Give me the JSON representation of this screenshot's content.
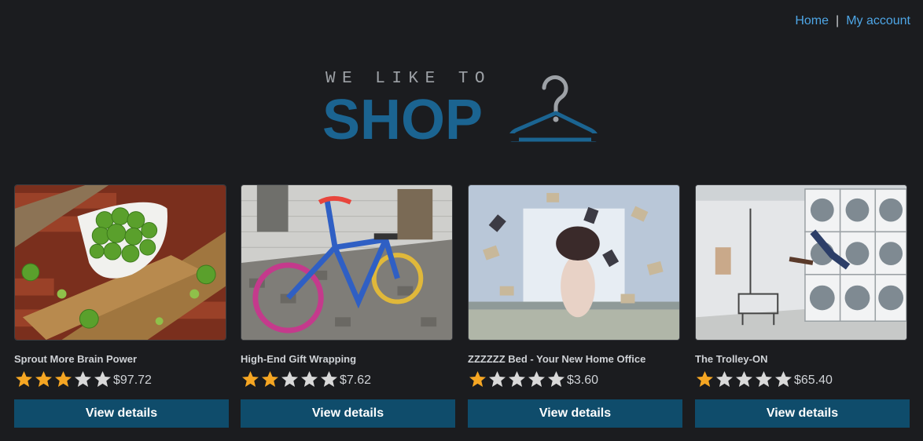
{
  "nav": {
    "home": "Home",
    "separator": "|",
    "account": "My account"
  },
  "logo": {
    "tagline": "WE LIKE TO",
    "word": "SHOP",
    "color": "#1b6491",
    "icon": "hanger-icon"
  },
  "colors": {
    "star_filled": "#f5a623",
    "star_empty": "#d9d9d9",
    "button_bg": "#0f4c6b",
    "link": "#4ea6e6"
  },
  "products": [
    {
      "name": "Sprout More Brain Power",
      "rating": 3,
      "max_rating": 5,
      "price": "$97.72",
      "button": "View details",
      "image": "brussels-sprouts-photo"
    },
    {
      "name": "High-End Gift Wrapping",
      "rating": 2,
      "max_rating": 5,
      "price": "$7.62",
      "button": "View details",
      "image": "knitted-bicycle-photo"
    },
    {
      "name": "ZZZZZZ Bed - Your New Home Office",
      "rating": 1,
      "max_rating": 5,
      "price": "$3.60",
      "button": "View details",
      "image": "bed-flying-books-photo"
    },
    {
      "name": "The Trolley-ON",
      "rating": 1,
      "max_rating": 5,
      "price": "$65.40",
      "button": "View details",
      "image": "laundromat-photo"
    }
  ]
}
